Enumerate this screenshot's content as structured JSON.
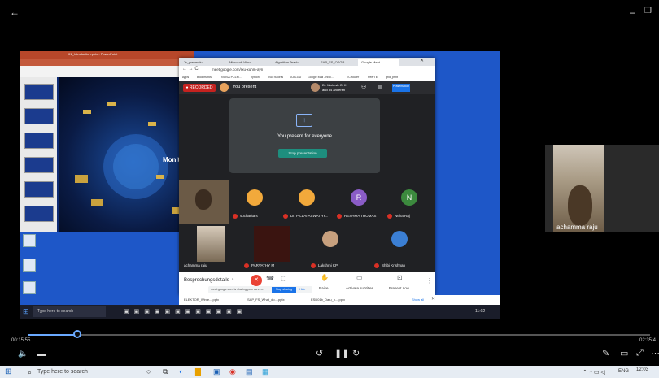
{
  "player": {
    "back_icon": "arrow-left",
    "minimize_icon": "minus",
    "restore_icon": "square",
    "time_elapsed": "00:15:55",
    "time_total": "02:35:4",
    "progress_fraction": 0.08
  },
  "ppt": {
    "title": "01_Introduction.pptx - PowerPoint",
    "slide_title": "Monit"
  },
  "browser": {
    "tabs": [
      "Ts_preventiv...",
      "Microsoft Word",
      "Algorithm Teach...",
      "SAP_FS_OSGR...",
      "Google Meet"
    ],
    "address": "meet.google.com/rxu-xuhm-ayn",
    "bookmarks": [
      "Apps",
      "Bookmarks",
      "NVISA PCLM...",
      "python",
      "ISM tutorial",
      "SOB-GD",
      "Google Mail - nBo...",
      "TC router",
      "PeerTE",
      "grid_print"
    ]
  },
  "meet": {
    "recorded_label": "RECORDED",
    "you_present": "You present",
    "host_line1": "Dr. Mahesh G. K.",
    "host_line2": "and 34 anderen",
    "present_icon_label": "Prasentation",
    "present_card_title": "You present for everyone",
    "stop_presenting": "Stop presentation",
    "participants": [
      {
        "name": "sucharita s",
        "initial": "",
        "color": "#f2a93b"
      },
      {
        "name": "Dr. PILLAI ASWATHY...",
        "initial": "",
        "color": "#f2a93b"
      },
      {
        "name": "RESHMA THOMAS",
        "initial": "R",
        "color": "#8a5cc6"
      },
      {
        "name": "Neha Raj",
        "initial": "N",
        "color": "#3c8a3e"
      },
      {
        "name": "achamma raju",
        "initial": "",
        "color": ""
      },
      {
        "name": "PARVATHY M",
        "initial": "",
        "color": ""
      },
      {
        "name": "Lakshmi KP",
        "initial": "",
        "color": ""
      },
      {
        "name": "Shibi Krishnan",
        "initial": "",
        "color": "#3b7fd4"
      }
    ],
    "controls": {
      "meeting_details": "Besprechungsdetails",
      "presenting_notice": "meet.google.com is sharing your screen.",
      "stop_sharing": "Stop sharing",
      "hide": "Hide",
      "raise": "Raise",
      "captions": "Activate subtitles",
      "present_now": "Present now"
    }
  },
  "win_taskbar_inner": {
    "search": "Type here to search",
    "downloads": [
      "ELEKTOR_Winte....pptx",
      "SAP_FS_What_do....pptx",
      "ESD01b_Datu_p....pptx"
    ],
    "show_all": "Show all",
    "time": "11:02"
  },
  "side_tile": {
    "name": "achamma raju"
  },
  "taskbar": {
    "search": "Type here to search",
    "lang": "ENG",
    "time": "12:03"
  }
}
